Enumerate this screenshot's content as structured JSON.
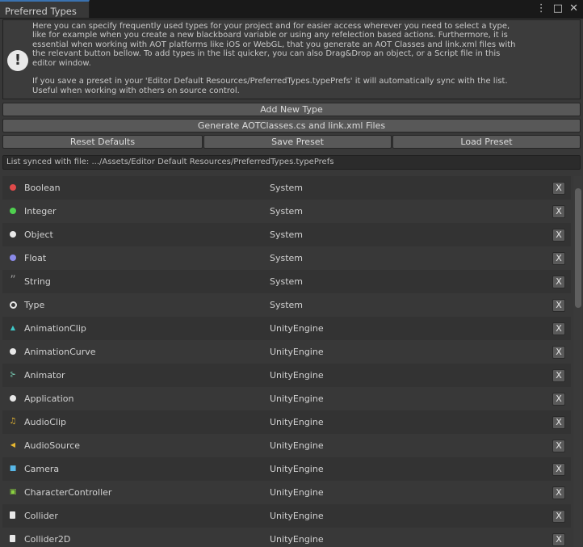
{
  "window": {
    "tab_title": "Preferred Types",
    "menu_glyph": "⋮",
    "maximize_glyph": "□",
    "close_glyph": "✕"
  },
  "help": {
    "icon_glyph": "!",
    "text": "Here you can specify frequently used types for your project and for easier access wherever you need to select a type,\nlike for example when you create a new blackboard variable or using any refelection based actions. Furthermore, it is\nessential when working with AOT platforms like iOS or WebGL, that you generate an AOT Classes and link.xml files with\nthe relevant button bellow. To add types in the list quicker, you can also Drag&Drop an object, or a Script file in this\neditor window.\n\nIf you save a preset in your 'Editor Default Resources/PreferredTypes.typePrefs' it will automatically sync with the list.\nUseful when working with others on source control."
  },
  "buttons": {
    "add_new_type": "Add New Type",
    "generate": "Generate AOTClasses.cs and link.xml Files",
    "reset_defaults": "Reset Defaults",
    "save_preset": "Save Preset",
    "load_preset": "Load Preset"
  },
  "sync_text": "List synced with file: .../Assets/Editor Default Resources/PreferredTypes.typePrefs",
  "remove_label": "X",
  "types": [
    {
      "name": "Boolean",
      "ns": "System",
      "icon": "red-dot-icon",
      "color": "#e04a4a"
    },
    {
      "name": "Integer",
      "ns": "System",
      "icon": "green-dot-icon",
      "color": "#4fd04f"
    },
    {
      "name": "Object",
      "ns": "System",
      "icon": "white-dot-icon",
      "color": "#e8e8e8"
    },
    {
      "name": "Float",
      "ns": "System",
      "icon": "blue-dot-icon",
      "color": "#8a8ae8"
    },
    {
      "name": "String",
      "ns": "System",
      "icon": "quote-icon",
      "color": "#9a9a9a"
    },
    {
      "name": "Type",
      "ns": "System",
      "icon": "ring-icon",
      "color": "#e8e8e8"
    },
    {
      "name": "AnimationClip",
      "ns": "UnityEngine",
      "icon": "animation-clip-icon",
      "color": "#3fc8c8"
    },
    {
      "name": "AnimationCurve",
      "ns": "UnityEngine",
      "icon": "white-dot-icon",
      "color": "#e8e8e8"
    },
    {
      "name": "Animator",
      "ns": "UnityEngine",
      "icon": "animator-icon",
      "color": "#7ad0b8"
    },
    {
      "name": "Application",
      "ns": "UnityEngine",
      "icon": "white-dot-icon",
      "color": "#e8e8e8"
    },
    {
      "name": "AudioClip",
      "ns": "UnityEngine",
      "icon": "music-note-icon",
      "color": "#e8b830"
    },
    {
      "name": "AudioSource",
      "ns": "UnityEngine",
      "icon": "speaker-icon",
      "color": "#e8b830"
    },
    {
      "name": "Camera",
      "ns": "UnityEngine",
      "icon": "camera-icon",
      "color": "#58b8e8"
    },
    {
      "name": "CharacterController",
      "ns": "UnityEngine",
      "icon": "character-icon",
      "color": "#8ad040"
    },
    {
      "name": "Collider",
      "ns": "UnityEngine",
      "icon": "file-icon",
      "color": "#e8e8e8"
    },
    {
      "name": "Collider2D",
      "ns": "UnityEngine",
      "icon": "file-icon",
      "color": "#e8e8e8"
    }
  ]
}
